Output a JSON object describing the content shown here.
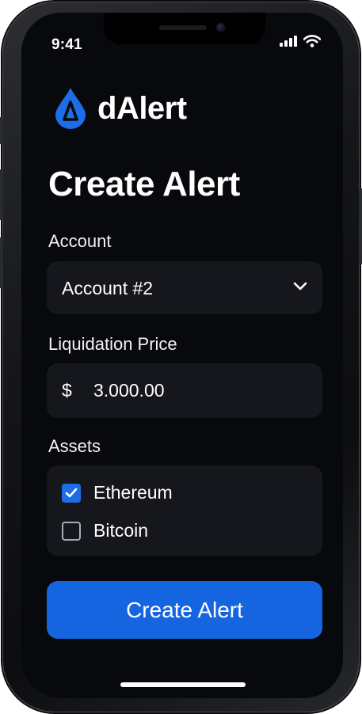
{
  "status_bar": {
    "time": "9:41",
    "icons": [
      "signal-icon",
      "wifi-icon"
    ]
  },
  "brand": {
    "name": "dAlert",
    "logo_icon": "drop-logo-icon",
    "logo_color": "#1e6de8"
  },
  "page": {
    "title": "Create Alert"
  },
  "form": {
    "account": {
      "label": "Account",
      "selected_value": "Account #2",
      "icon": "chevron-down-icon"
    },
    "liquidation_price": {
      "label": "Liquidation Price",
      "currency_symbol": "$",
      "value": "3.000.00"
    },
    "assets": {
      "label": "Assets",
      "items": [
        {
          "label": "Ethereum",
          "checked": true
        },
        {
          "label": "Bitcoin",
          "checked": false
        }
      ]
    },
    "submit_label": "Create Alert"
  },
  "colors": {
    "background": "#08090c",
    "field": "#16171c",
    "accent": "#1565e0",
    "checkbox_checked": "#1e6de8"
  }
}
